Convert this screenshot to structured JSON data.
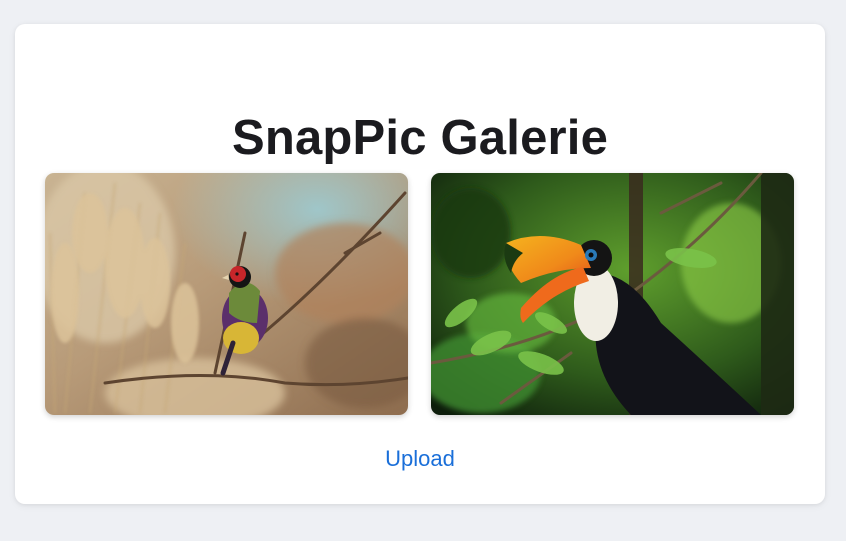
{
  "page": {
    "title": "SnapPic Galerie",
    "upload_label": "Upload"
  },
  "gallery": {
    "images": [
      {
        "subject": "gouldian-finch-on-branch"
      },
      {
        "subject": "toucan-on-branch"
      }
    ]
  },
  "colors": {
    "background": "#eef0f4",
    "card": "#ffffff",
    "title": "#1b1b1f",
    "link": "#1a6fd9"
  }
}
